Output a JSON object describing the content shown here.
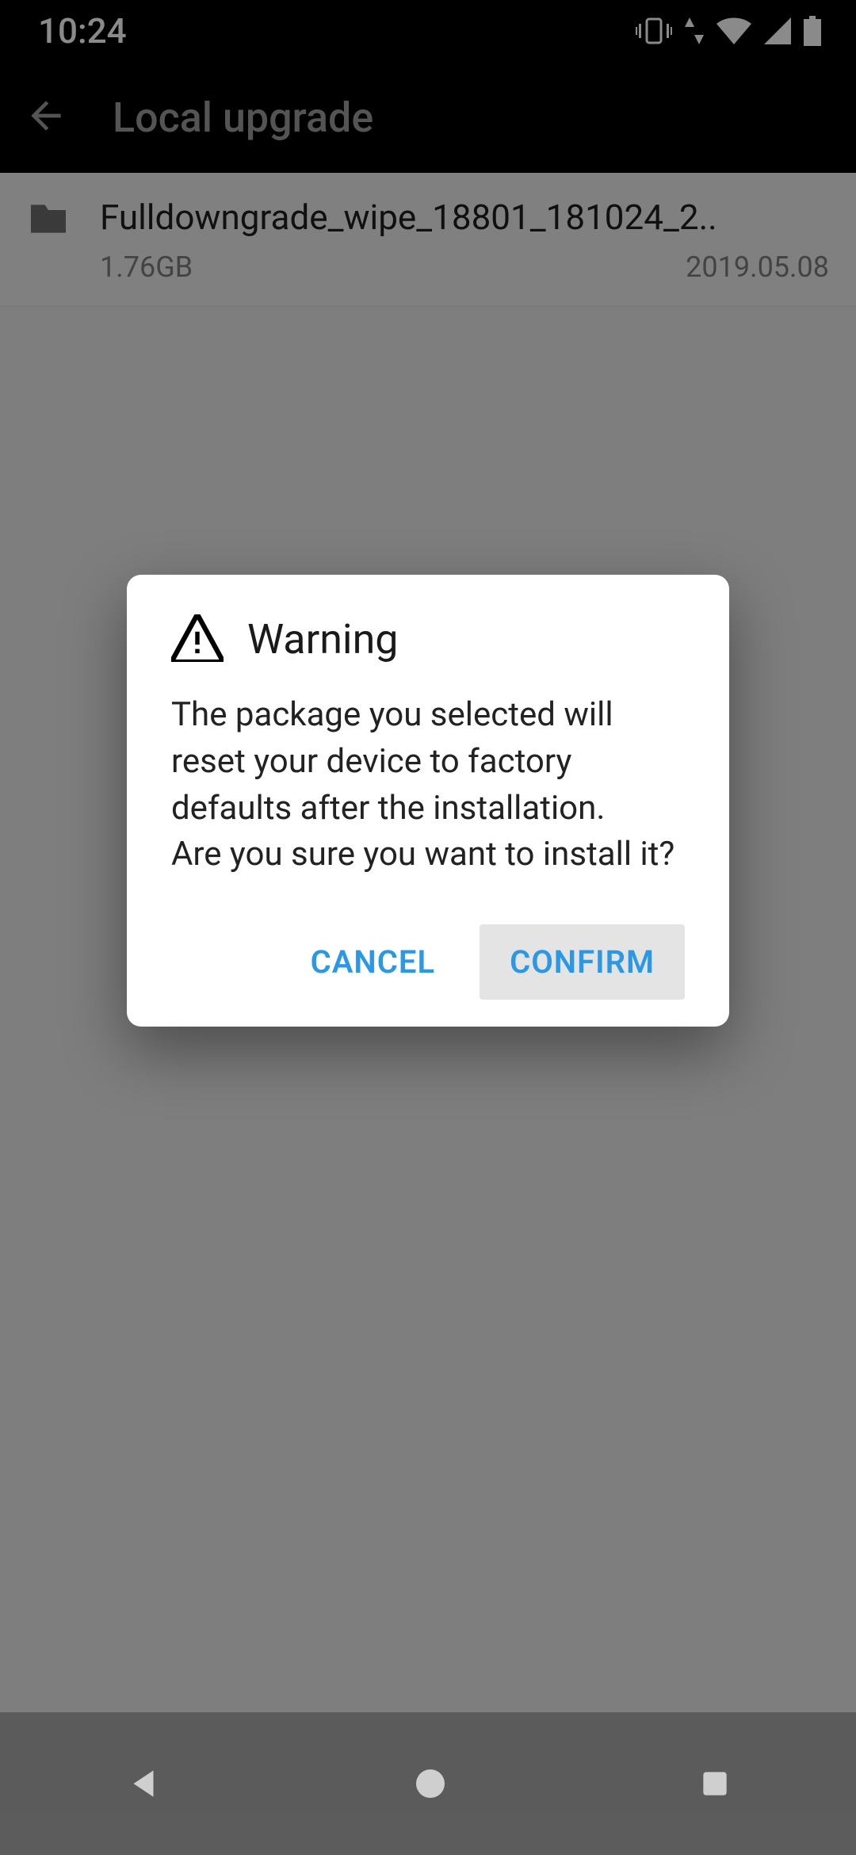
{
  "statusbar": {
    "time": "10:24"
  },
  "appbar": {
    "title": "Local upgrade"
  },
  "files": [
    {
      "name": "Fulldowngrade_wipe_18801_181024_2..",
      "size": "1.76GB",
      "date": "2019.05.08"
    }
  ],
  "dialog": {
    "title": "Warning",
    "body": "The package you selected will reset your device to factory defaults after the installation.\nAre you sure you want to install it?",
    "cancel_label": "CANCEL",
    "confirm_label": "CONFIRM"
  }
}
